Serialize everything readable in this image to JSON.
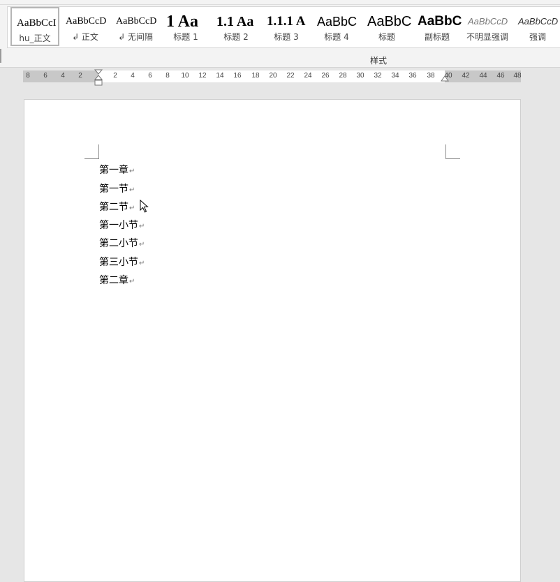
{
  "styles_gallery": {
    "group_label": "样式",
    "items": [
      {
        "preview": "AaBbCcI",
        "name": "hu_正文"
      },
      {
        "preview": "AaBbCcD",
        "name": "↲ 正文"
      },
      {
        "preview": "AaBbCcD",
        "name": "↲ 无间隔"
      },
      {
        "preview": "1 Aa",
        "name": "标题 1"
      },
      {
        "preview": "1.1 Aa",
        "name": "标题 2"
      },
      {
        "preview": "1.1.1 A",
        "name": "标题 3"
      },
      {
        "preview": "AaBbC",
        "name": "标题 4"
      },
      {
        "preview": "AaBbC",
        "name": "标题"
      },
      {
        "preview": "AaBbC",
        "name": "副标题"
      },
      {
        "preview": "AaBbCcD",
        "name": "不明显强调"
      },
      {
        "preview": "AaBbCcD",
        "name": "强调"
      }
    ]
  },
  "ruler": {
    "labels": [
      "8",
      "6",
      "4",
      "2",
      "2",
      "4",
      "6",
      "8",
      "10",
      "12",
      "14",
      "16",
      "18",
      "20",
      "22",
      "24",
      "26",
      "28",
      "30",
      "32",
      "34",
      "36",
      "38",
      "40",
      "42",
      "44",
      "46",
      "48"
    ]
  },
  "document": {
    "paragraph_mark": "↵",
    "lines": [
      "第一章",
      "第一节",
      "第二节",
      "第一小节",
      "第二小节",
      "第三小节",
      "第二章"
    ]
  },
  "colors": {
    "ribbon_bg": "#f3f3f3",
    "canvas_bg": "#e6e6e6",
    "ruler_margin": "#c8c8c8"
  }
}
